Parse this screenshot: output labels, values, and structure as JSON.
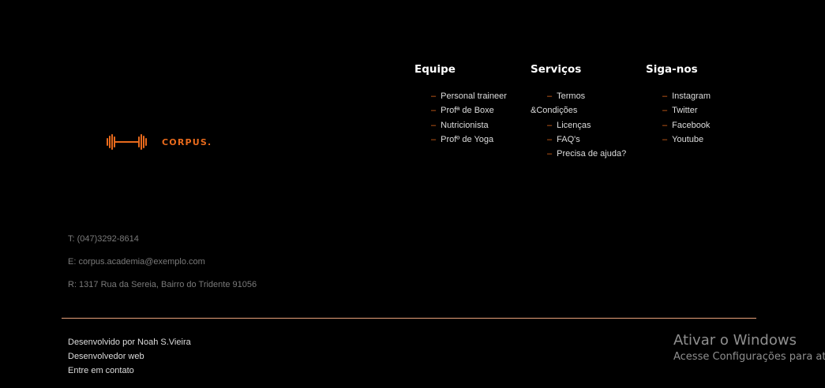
{
  "brand": {
    "name": "CORPUS.",
    "logo_icon": "barbell-icon",
    "accent": "#e86a1c"
  },
  "columns": {
    "equipe": {
      "title": "Equipe",
      "items": [
        "Personal traineer",
        "Profª de Boxe",
        "Nutricionista",
        "Profº de Yoga"
      ]
    },
    "servicos": {
      "title": "Serviços",
      "items": [
        "Termos",
        "&Condições",
        "Licenças",
        "FAQ's",
        "Precisa de ajuda?"
      ]
    },
    "siga": {
      "title": "Siga-nos",
      "items": [
        "Instagram",
        "Twitter",
        "Facebook",
        "Youtube"
      ]
    }
  },
  "contact": {
    "phone": "T: (047)3292-8614",
    "email": "E: corpus.academia@exemplo.com",
    "address": "R: 1317 Rua da Sereia, Bairro do Tridente 91056"
  },
  "credits": {
    "line1": "Desenvolvido por Noah S.Vieira",
    "line2": "Desenvolvedor web",
    "line3": "Entre em contato"
  },
  "watermark": {
    "title": "Ativar o Windows",
    "subtitle": "Acesse Configurações para ativar o Windows."
  }
}
